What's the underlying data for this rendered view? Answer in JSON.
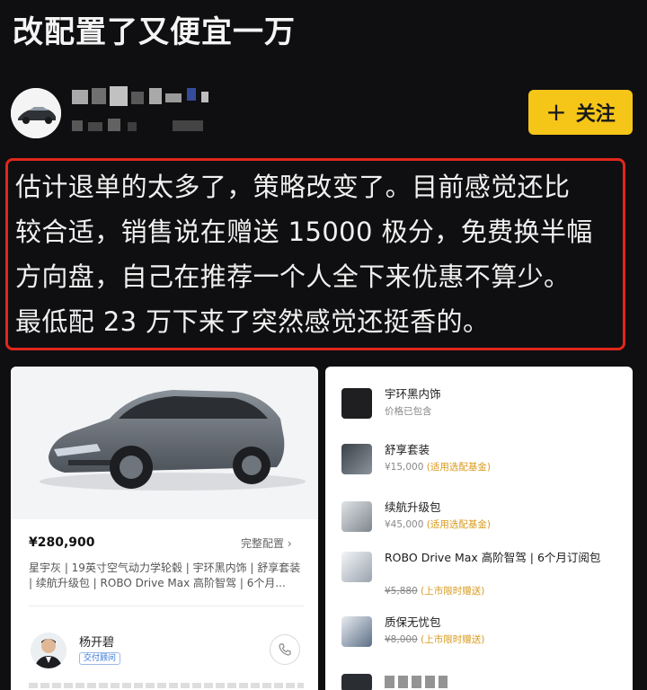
{
  "page": {
    "title": "改配置了又便宜一万"
  },
  "author": {
    "follow_label": "关注"
  },
  "post": {
    "text": "估计退单的太多了，策略改变了。目前感觉还比\n较合适，销售说在赠送 15000 极分，免费换半幅\n方向盘，自己在推荐一个人全下来优惠不算少。\n最低配 23 万下来了突然感觉还挺香的。"
  },
  "config_card": {
    "price": "¥280,900",
    "full_config_label": "完整配置 ›",
    "summary": "星宇灰 | 19英寸空气动力学轮毂 | 宇环黑内饰 | 舒享套装 | 续航升级包 | ROBO Drive Max 高阶智驾 | 6个月...",
    "sales": {
      "name": "杨开碧",
      "badge": "交付顾问"
    }
  },
  "options": [
    {
      "name": "宇环黑内饰",
      "price": "价格已包含",
      "strike": "",
      "note": "",
      "thumb_color": "#1f1f22"
    },
    {
      "name": "舒享套装",
      "price": "¥15,000",
      "strike": "",
      "note": "(适用选配基金)",
      "thumb_color": "#4a5058"
    },
    {
      "name": "续航升级包",
      "price": "¥45,000",
      "strike": "",
      "note": "(适用选配基金)",
      "thumb_color": "#8a9096"
    },
    {
      "name": "ROBO Drive Max 高阶智驾 | 6个月订阅包",
      "price": "",
      "strike": "¥5,880",
      "note": "(上市限时赠送)",
      "thumb_color": "#c9ced6"
    },
    {
      "name": "质保无忧包",
      "price": "",
      "strike": "¥8,000",
      "note": "(上市限时赠送)",
      "thumb_color": "#5d6f86"
    }
  ],
  "colors": {
    "accent": "#f5c518",
    "highlight_border": "#e0271b",
    "background": "#0f0f11"
  }
}
